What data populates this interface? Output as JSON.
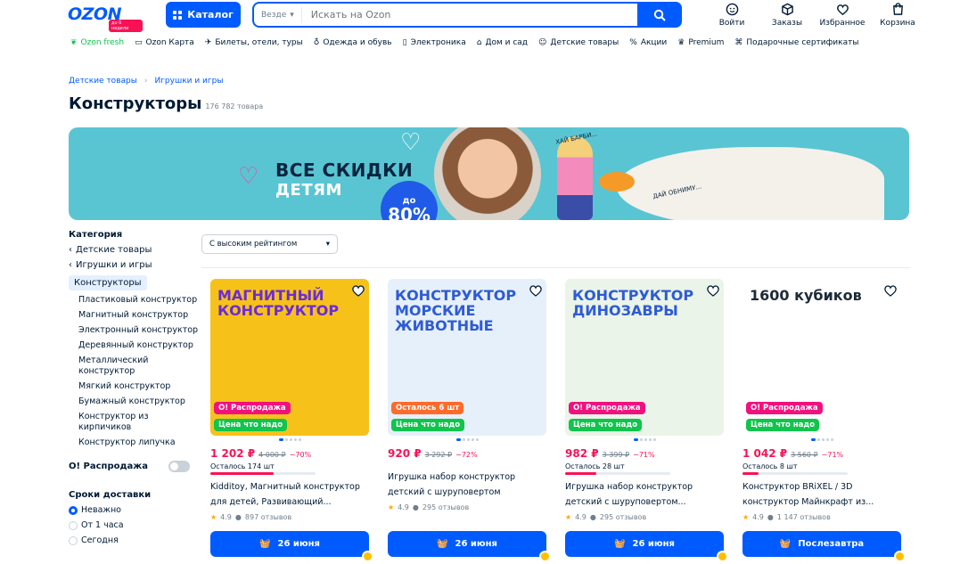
{
  "header": {
    "logo": "OZON",
    "logo_sub": "до 6 недели",
    "catalog_label": "Каталог",
    "search": {
      "scope": "Везде",
      "placeholder": "Искать на Ozon"
    },
    "actions": [
      {
        "label": "Войти",
        "icon": "user-icon"
      },
      {
        "label": "Заказы",
        "icon": "box-icon"
      },
      {
        "label": "Избранное",
        "icon": "heart-icon"
      },
      {
        "label": "Корзина",
        "icon": "cart-icon"
      }
    ]
  },
  "nav": [
    {
      "label": "Ozon fresh",
      "icon": "leaf-icon",
      "accent": "#10c44c"
    },
    {
      "label": "Ozon Карта",
      "icon": "card-icon"
    },
    {
      "label": "Билеты, отели, туры",
      "icon": "plane-icon"
    },
    {
      "label": "Одежда и обувь",
      "icon": "clothes-icon"
    },
    {
      "label": "Электроника",
      "icon": "phone-icon"
    },
    {
      "label": "Дом и сад",
      "icon": "home-icon"
    },
    {
      "label": "Детские товары",
      "icon": "baby-icon"
    },
    {
      "label": "Акции",
      "icon": "percent-icon"
    },
    {
      "label": "Premium",
      "icon": "crown-icon"
    },
    {
      "label": "Подарочные сертификаты",
      "icon": "gift-icon"
    }
  ],
  "breadcrumbs": [
    "Детские товары",
    "Игрушки и игры"
  ],
  "page": {
    "title": "Конструкторы",
    "count": "176 782 товара"
  },
  "banner": {
    "line1": "ВСЕ СКИДКИ",
    "line2": "ДЕТЯМ",
    "discount_prefix": "до",
    "discount": "80%",
    "note1": "ХАЙ БАРБИ...",
    "note2": "ДАЙ ОБНИМУ..."
  },
  "sidebar": {
    "category_heading": "Категория",
    "parents": [
      "Детские товары",
      "Игрушки и игры"
    ],
    "active": "Конструкторы",
    "children": [
      "Пластиковый конструктор",
      "Магнитный конструктор",
      "Электронный конструктор",
      "Деревянный конструктор",
      "Металлический конструктор",
      "Мягкий конструктор",
      "Бумажный конструктор",
      "Конструктор из кирпичиков",
      "Конструктор липучка"
    ],
    "sale_label": "О! Распродажа",
    "delivery_heading": "Сроки доставки",
    "delivery_options": [
      {
        "label": "Неважно",
        "selected": true
      },
      {
        "label": "От 1 часа",
        "selected": false
      },
      {
        "label": "Сегодня",
        "selected": false
      }
    ]
  },
  "sort": {
    "selected": "С высоким рейтингом"
  },
  "products": [
    {
      "image_title": "МАГНИТНЫЙ КОНСТРУКТОР",
      "image_bg": "#f6c21a",
      "badge1": "О! Распродажа",
      "badge1_color": "red",
      "badge2": "Цена что надо",
      "price": "1 202 ₽",
      "old_price": "4 000 ₽",
      "discount": "−70%",
      "stock": "Осталось 174 шт",
      "stock_fill": 0.6,
      "name": "Kidditoy, Магнитный конструктор для детей, Развивающий...",
      "rating": "4.9",
      "reviews": "897 отзывов",
      "button": "26 июня"
    },
    {
      "image_title": "КОНСТРУКТОР МОРСКИЕ ЖИВОТНЫЕ",
      "image_bg": "#e6f0fa",
      "badge1": "Осталось 6 шт",
      "badge1_color": "orange",
      "badge2": "Цена что надо",
      "price": "920 ₽",
      "old_price": "3 292 ₽",
      "discount": "−72%",
      "stock": "",
      "stock_fill": 0,
      "name": "Игрушка набор конструктор детский с шуруповертом морские...",
      "rating": "4.9",
      "reviews": "295 отзывов",
      "button": "26 июня"
    },
    {
      "image_title": "КОНСТРУКТОР ДИНОЗАВРЫ",
      "image_bg": "#eaf4e8",
      "badge1": "О! Распродажа",
      "badge1_color": "red",
      "badge2": "Цена что надо",
      "price": "982 ₽",
      "old_price": "3 399 ₽",
      "discount": "−71%",
      "stock": "Осталось 28 шт",
      "stock_fill": 0.3,
      "name": "Игрушка набор конструктор детский с шуруповертом...",
      "rating": "4.9",
      "reviews": "295 отзывов",
      "button": "26 июня"
    },
    {
      "image_title": "1600 кубиков",
      "image_bg": "#ffffff",
      "badge1": "О! Распродажа",
      "badge1_color": "red",
      "badge2": "Цена что надо",
      "price": "1 042 ₽",
      "old_price": "3 560 ₽",
      "discount": "−71%",
      "stock": "Осталось 8 шт",
      "stock_fill": 0.15,
      "name": "Конструктор BRiXEL / 3D конструктор Майнкрафт из...",
      "rating": "4.9",
      "reviews": "1 147 отзывов",
      "button": "Послезавтра"
    }
  ]
}
